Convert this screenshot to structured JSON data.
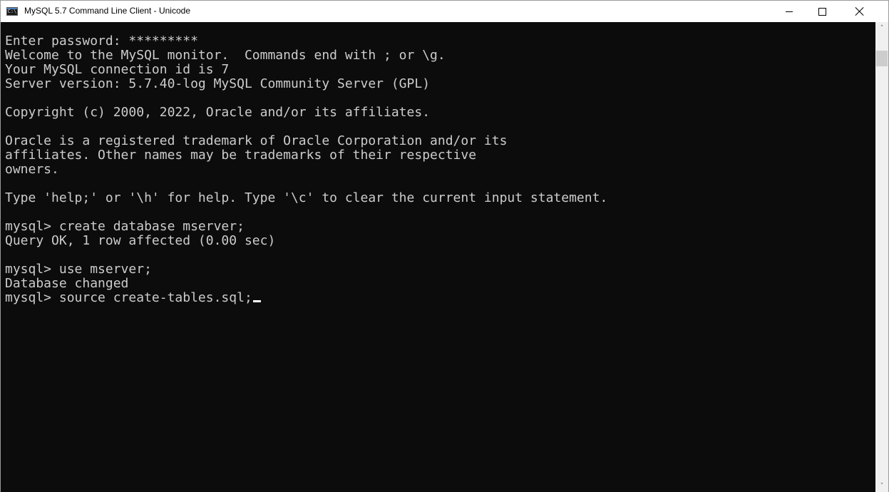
{
  "window": {
    "title": "MySQL 5.7 Command Line Client - Unicode",
    "icon": "console-app-icon",
    "icon_glyph": "C:\\"
  },
  "caption_buttons": {
    "minimize": "minimize-icon",
    "maximize": "maximize-icon",
    "close": "close-icon"
  },
  "console": {
    "lines": [
      "Enter password: *********",
      "Welcome to the MySQL monitor.  Commands end with ; or \\g.",
      "Your MySQL connection id is 7",
      "Server version: 5.7.40-log MySQL Community Server (GPL)",
      "",
      "Copyright (c) 2000, 2022, Oracle and/or its affiliates.",
      "",
      "Oracle is a registered trademark of Oracle Corporation and/or its",
      "affiliates. Other names may be trademarks of their respective",
      "owners.",
      "",
      "Type 'help;' or '\\h' for help. Type '\\c' to clear the current input statement.",
      "",
      "mysql> create database mserver;",
      "Query OK, 1 row affected (0.00 sec)",
      "",
      "mysql> use mserver;",
      "Database changed",
      "mysql> source create-tables.sql;"
    ],
    "colors": {
      "background": "#0c0c0c",
      "foreground": "#cccccc",
      "cursor": "#ffffff"
    }
  },
  "scrollbar": {
    "up_arrow": "˄",
    "down_arrow": "˅"
  }
}
